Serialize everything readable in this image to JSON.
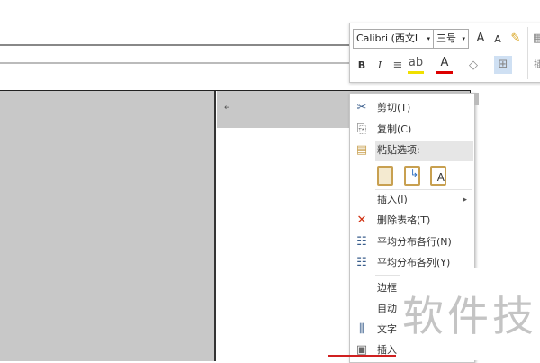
{
  "toolbar": {
    "font_name": "Calibri (西文I",
    "font_size": "三号",
    "grow_font": "A",
    "shrink_font": "A",
    "bold": "B",
    "italic": "I",
    "font_color": "A",
    "insert_partial": "插"
  },
  "document": {
    "paragraph_mark": "↵"
  },
  "context_menu": {
    "items": [
      {
        "label": "剪切(T)",
        "icon": "scissors-icon",
        "glyph": "✂"
      },
      {
        "label": "复制(C)",
        "icon": "copy-icon",
        "glyph": "⎘"
      },
      {
        "label": "粘贴选项:",
        "icon": "paste-icon",
        "glyph": "📋"
      },
      {
        "label": "插入(I)",
        "icon": "",
        "glyph": ""
      },
      {
        "label": "删除表格(T)",
        "icon": "delete-table-icon",
        "glyph": "✕"
      },
      {
        "label": "平均分布各行(N)",
        "icon": "distribute-rows-icon",
        "glyph": "☷"
      },
      {
        "label": "平均分布各列(Y)",
        "icon": "distribute-columns-icon",
        "glyph": "☷"
      },
      {
        "label": "边框",
        "icon": "",
        "glyph": ""
      },
      {
        "label": "自动",
        "icon": "",
        "glyph": ""
      },
      {
        "label": "文字",
        "icon": "text-direction-icon",
        "glyph": "⫼"
      },
      {
        "label": "插入",
        "icon": "insert-caption-icon",
        "glyph": "▣"
      }
    ],
    "paste_options": [
      "keep-source-formatting",
      "merge-formatting",
      "keep-text-only"
    ],
    "submenu_arrow": "▸"
  },
  "watermark": {
    "text": "软件技"
  }
}
